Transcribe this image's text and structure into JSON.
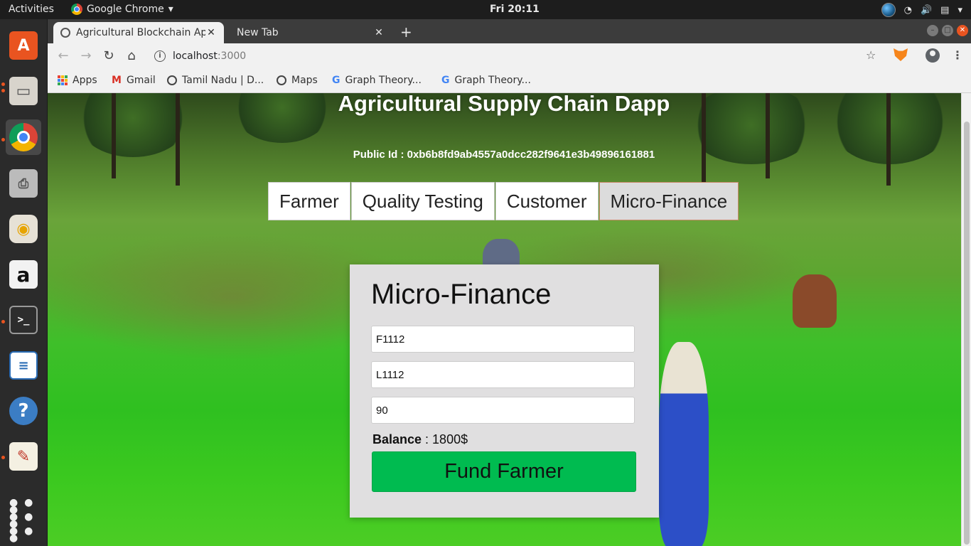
{
  "topbar": {
    "activities": "Activities",
    "app_name": "Google Chrome",
    "clock": "Fri 20:11"
  },
  "browser": {
    "tabs": [
      {
        "title": "Agricultural Blockchain Ap",
        "active": true
      },
      {
        "title": "New Tab",
        "active": false
      }
    ],
    "url_host": "localhost",
    "url_port": ":3000",
    "bookmarks": [
      {
        "label": "Apps",
        "icon": "apps-grid-icon"
      },
      {
        "label": "Gmail",
        "icon": "gmail-icon"
      },
      {
        "label": "Tamil Nadu | D...",
        "icon": "globe-icon"
      },
      {
        "label": "Maps",
        "icon": "globe-icon"
      },
      {
        "label": "Graph Theory...",
        "icon": "google-icon"
      },
      {
        "label": "Graph Theory...",
        "icon": "google-icon"
      }
    ]
  },
  "page": {
    "title": "Agricultural Supply Chain Dapp",
    "public_id": "Public Id : 0xb6b8fd9ab4557a0dcc282f9641e3b49896161881",
    "nav_tabs": [
      "Farmer",
      "Quality Testing",
      "Customer",
      "Micro-Finance"
    ],
    "selected_tab": "Micro-Finance",
    "card": {
      "heading": "Micro-Finance",
      "farmer_id_value": "F1112",
      "loan_id_value": "L1112",
      "amount_value": "90",
      "balance_label": "Balance",
      "balance_value": " : 1800$",
      "fund_button": "Fund Farmer"
    }
  },
  "colors": {
    "fund_button": "#00bb50",
    "ubuntu_accent": "#e95420",
    "card_bg": "#e0dfe0"
  }
}
